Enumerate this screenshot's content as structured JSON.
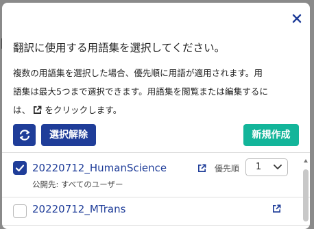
{
  "background": {
    "partial_char": "M"
  },
  "dialog": {
    "title": "翻訳に使用する用語集を選択してください。",
    "description_line1": "複数の用語集を選択した場合、優先順に用語が適用されます。用",
    "description_line2": "語集は最大5つまで選択できます。用語集を閲覧または編集するに",
    "description_line3_pre": "は、",
    "description_line3_post": " をクリックします。",
    "close_icon": "close-icon",
    "colors": {
      "primary": "#1f3d99",
      "accent": "#13b59a"
    }
  },
  "toolbar": {
    "refresh_icon": "refresh-icon",
    "clear_label": "選択解除",
    "new_label": "新規作成"
  },
  "glossaries": [
    {
      "name": "20220712_HumanScience",
      "checked": true,
      "visibility": "公開先: すべてのユーザー",
      "priority_label": "優先順",
      "priority": "1"
    },
    {
      "name": "20220712_MTrans",
      "checked": false
    }
  ]
}
